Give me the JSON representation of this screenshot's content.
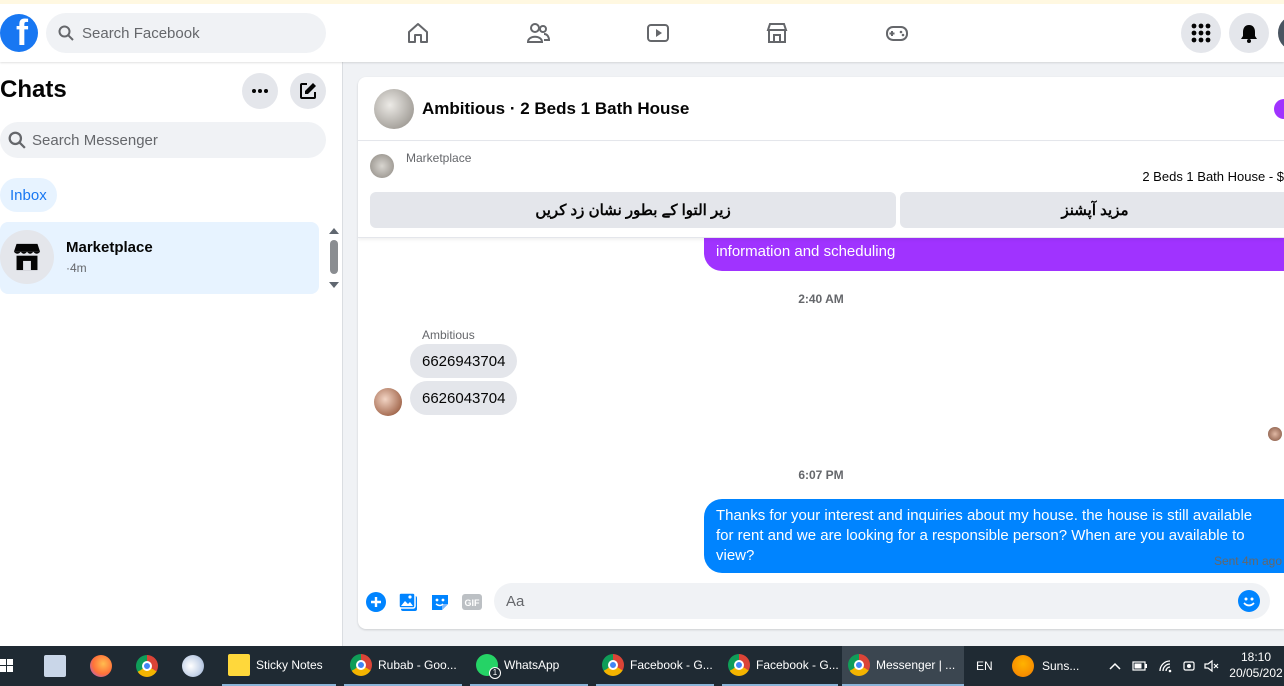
{
  "topnav": {
    "logo": "f",
    "search_placeholder": "Search Facebook",
    "icons": [
      "home-icon",
      "friends-icon",
      "watch-icon",
      "marketplace-icon",
      "gaming-icon"
    ]
  },
  "sidebar": {
    "title": "Chats",
    "search_placeholder": "Search Messenger",
    "filter": "Inbox",
    "chat": {
      "name": "Marketplace",
      "time": "·4m"
    }
  },
  "conversation": {
    "title": "Ambitious · 2 Beds 1 Bath House",
    "banner": {
      "label": "Marketplace",
      "listing": "2 Beds 1 Bath House - $",
      "button_left": "زیر التوا کے بطور نشان زد کریں",
      "button_right": "مزید آپشنز"
    },
    "messages": {
      "partial_sent": "information and  scheduling",
      "time1": "2:40 AM",
      "sender": "Ambitious",
      "recv1": "6626943704",
      "recv2": "6626043704",
      "time2": "6:07 PM",
      "sent": "Thanks for your interest and inquiries about my house. the house is still available for rent and we are looking for a responsible person? When are you available to view?",
      "status": "Sent 4m ago"
    },
    "composer": {
      "placeholder": "Aa",
      "gif": "GIF"
    }
  },
  "taskbar": {
    "items": [
      "Sticky Notes",
      "Rubab - Goo...",
      "WhatsApp",
      "Facebook - G...",
      "Facebook - G...",
      "Messenger | ..."
    ],
    "whatsapp_badge": "1",
    "lang": "EN",
    "weather": "Suns...",
    "time": "18:10",
    "date": "20/05/202"
  },
  "colors": {
    "accent": "#1877f2",
    "sent_bubble": "#0084ff",
    "purple": "#a033ff"
  }
}
